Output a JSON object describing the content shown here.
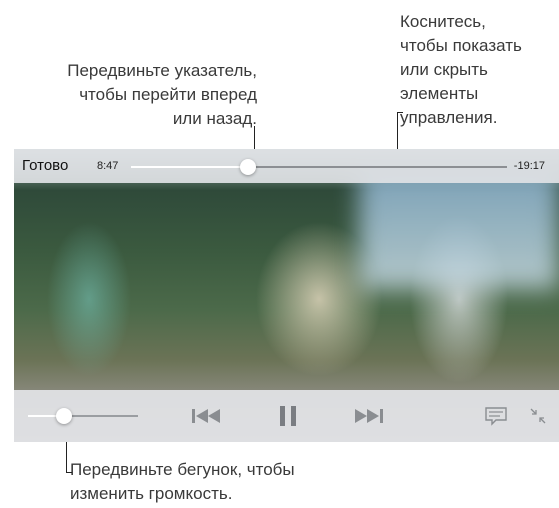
{
  "callouts": {
    "scrubber": "Передвиньте указатель,\nчтобы перейти вперед\nили назад.",
    "tap_controls": "Коснитесь,\nчтобы показать\nили скрыть\nэлементы\nуправления.",
    "volume": "Передвиньте бегунок, чтобы\nизменить громкость."
  },
  "player": {
    "done_label": "Готово",
    "time_elapsed": "8:47",
    "time_remaining": "-19:17",
    "playback_progress": 0.31,
    "volume_level": 0.33,
    "icons": {
      "prev": "skip-back-icon",
      "pause": "pause-icon",
      "next": "skip-forward-icon",
      "subtitles": "subtitles-icon",
      "shrink": "exit-fullscreen-icon"
    },
    "colors": {
      "bar_background": "#e0e2e5",
      "control_icon": "#8a8d91",
      "pause_icon": "#7a7d82"
    }
  }
}
